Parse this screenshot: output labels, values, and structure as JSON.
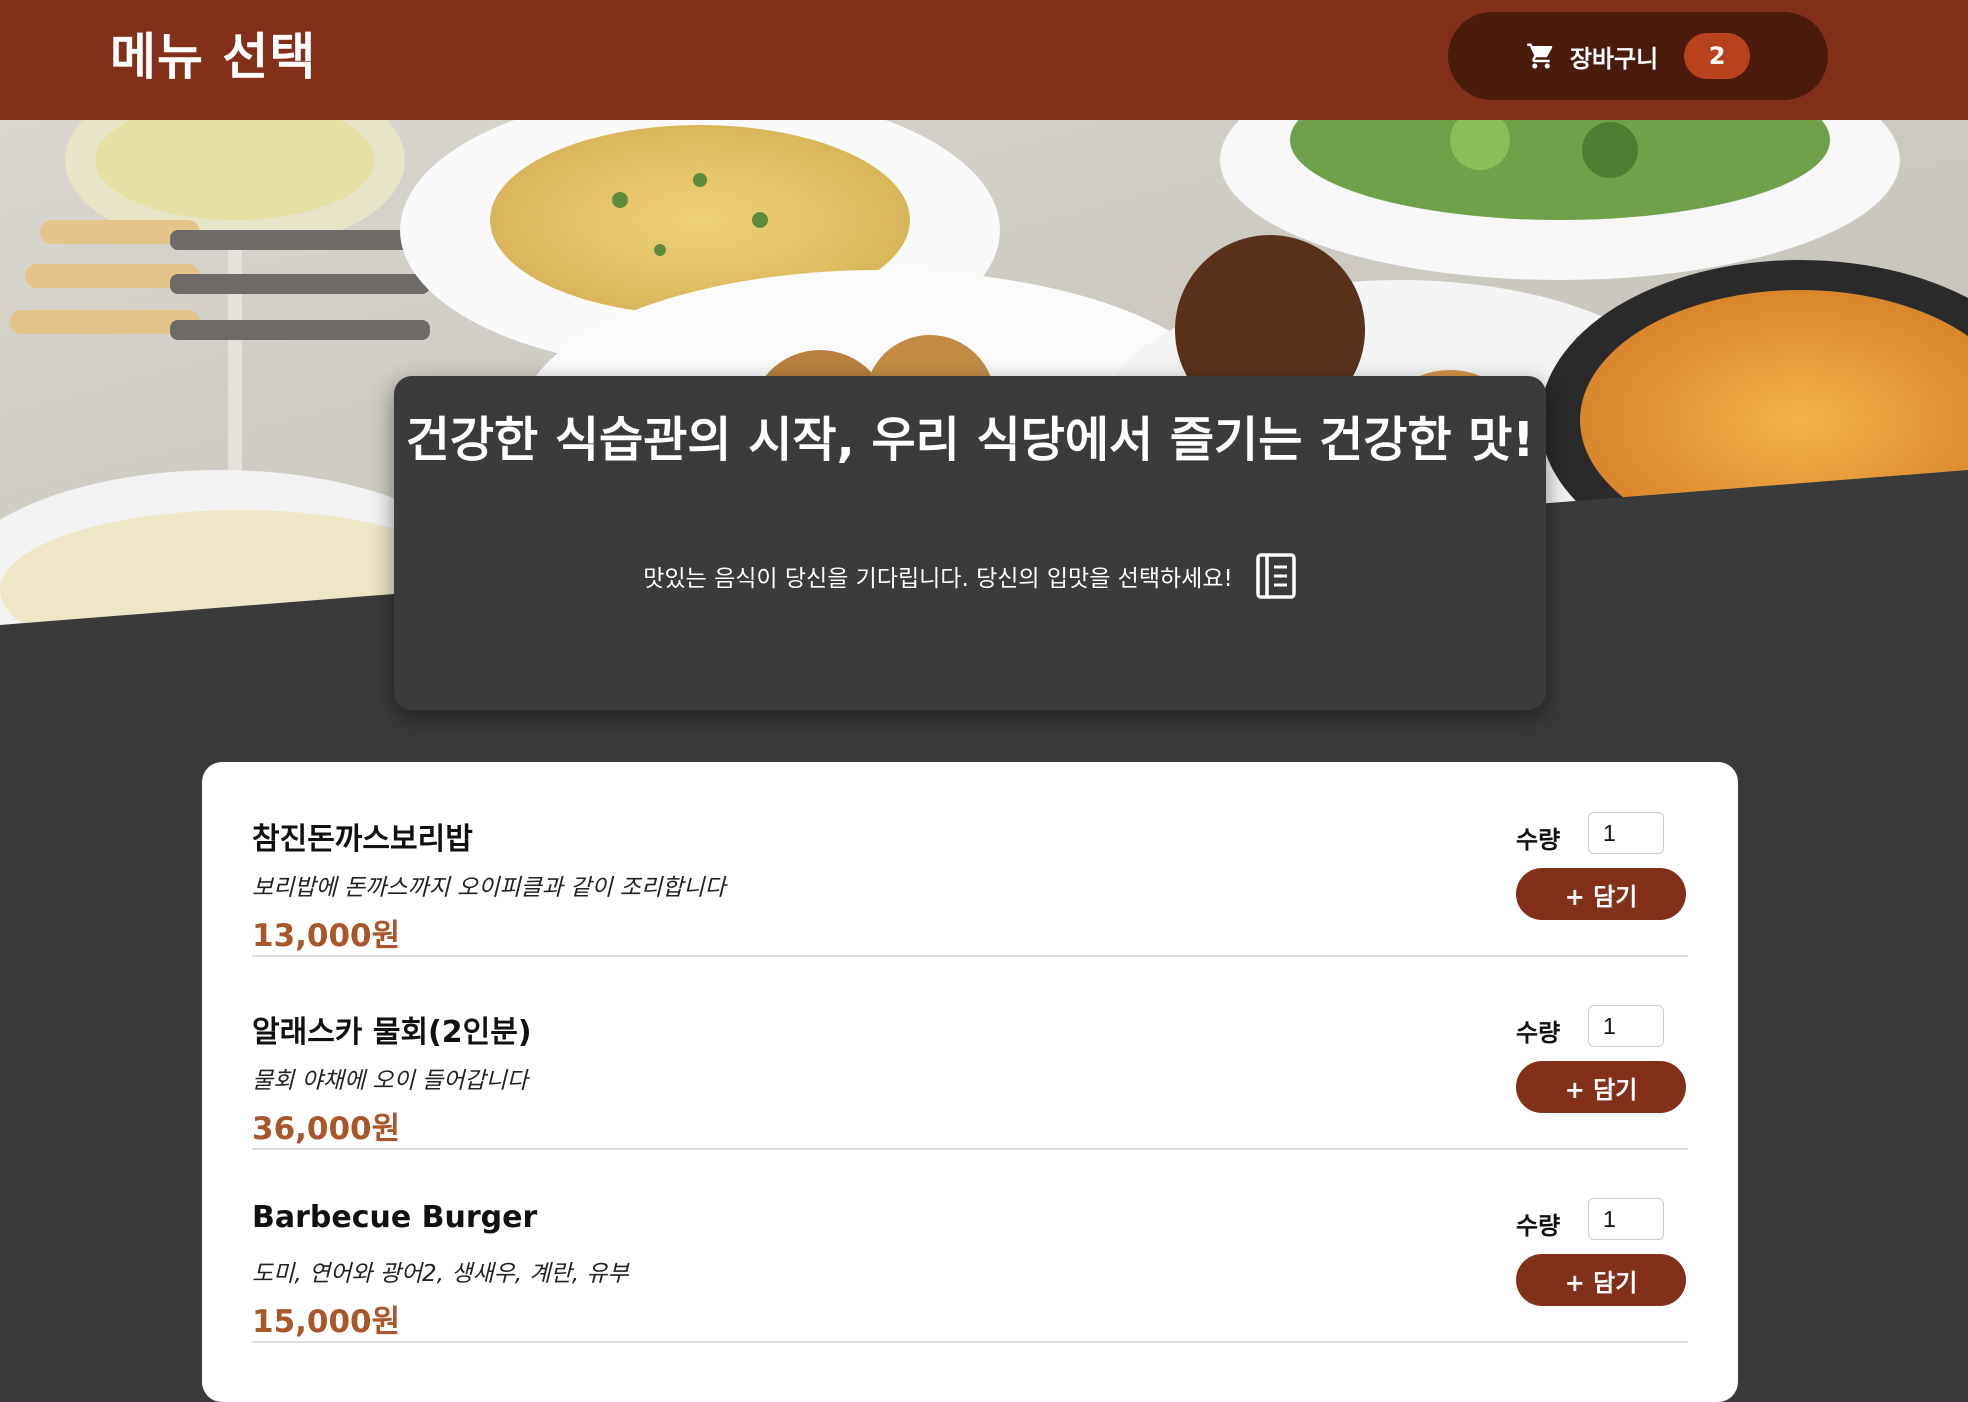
{
  "header": {
    "title": "메뉴 선택",
    "cart_label": "장바구니",
    "cart_count": "2"
  },
  "hero": {
    "title": "건강한 식습관의 시작, 우리 식당에서 즐기는 건강한 맛!",
    "subtitle": "맛있는 음식이 당신을 기다립니다. 당신의 입맛을 선택하세요!",
    "icon": "menu-book-icon"
  },
  "menu": {
    "items": [
      {
        "name": "참진돈까스보리밥",
        "description": "보리밥에 돈까스까지 오이피클과 같이 조리합니다",
        "price": "13,000원",
        "qty_label": "수량",
        "qty": "1",
        "add_label": "+ 담기"
      },
      {
        "name": "알래스카 물회(2인분)",
        "description": "물회 야채에 오이 들어갑니다",
        "price": "36,000원",
        "qty_label": "수량",
        "qty": "1",
        "add_label": "+ 담기"
      },
      {
        "name": "Barbecue Burger",
        "description": "도미, 연어와 광어2, 생새우, 계란, 유부",
        "price": "15,000원",
        "qty_label": "수량",
        "qty": "1",
        "add_label": "+ 담기"
      }
    ]
  },
  "colors": {
    "header_bg": "#82301a",
    "cart_bg": "#4a1a0b",
    "badge_bg": "#b8421c",
    "page_bg": "#3a3a3a",
    "price": "#a8562a"
  }
}
